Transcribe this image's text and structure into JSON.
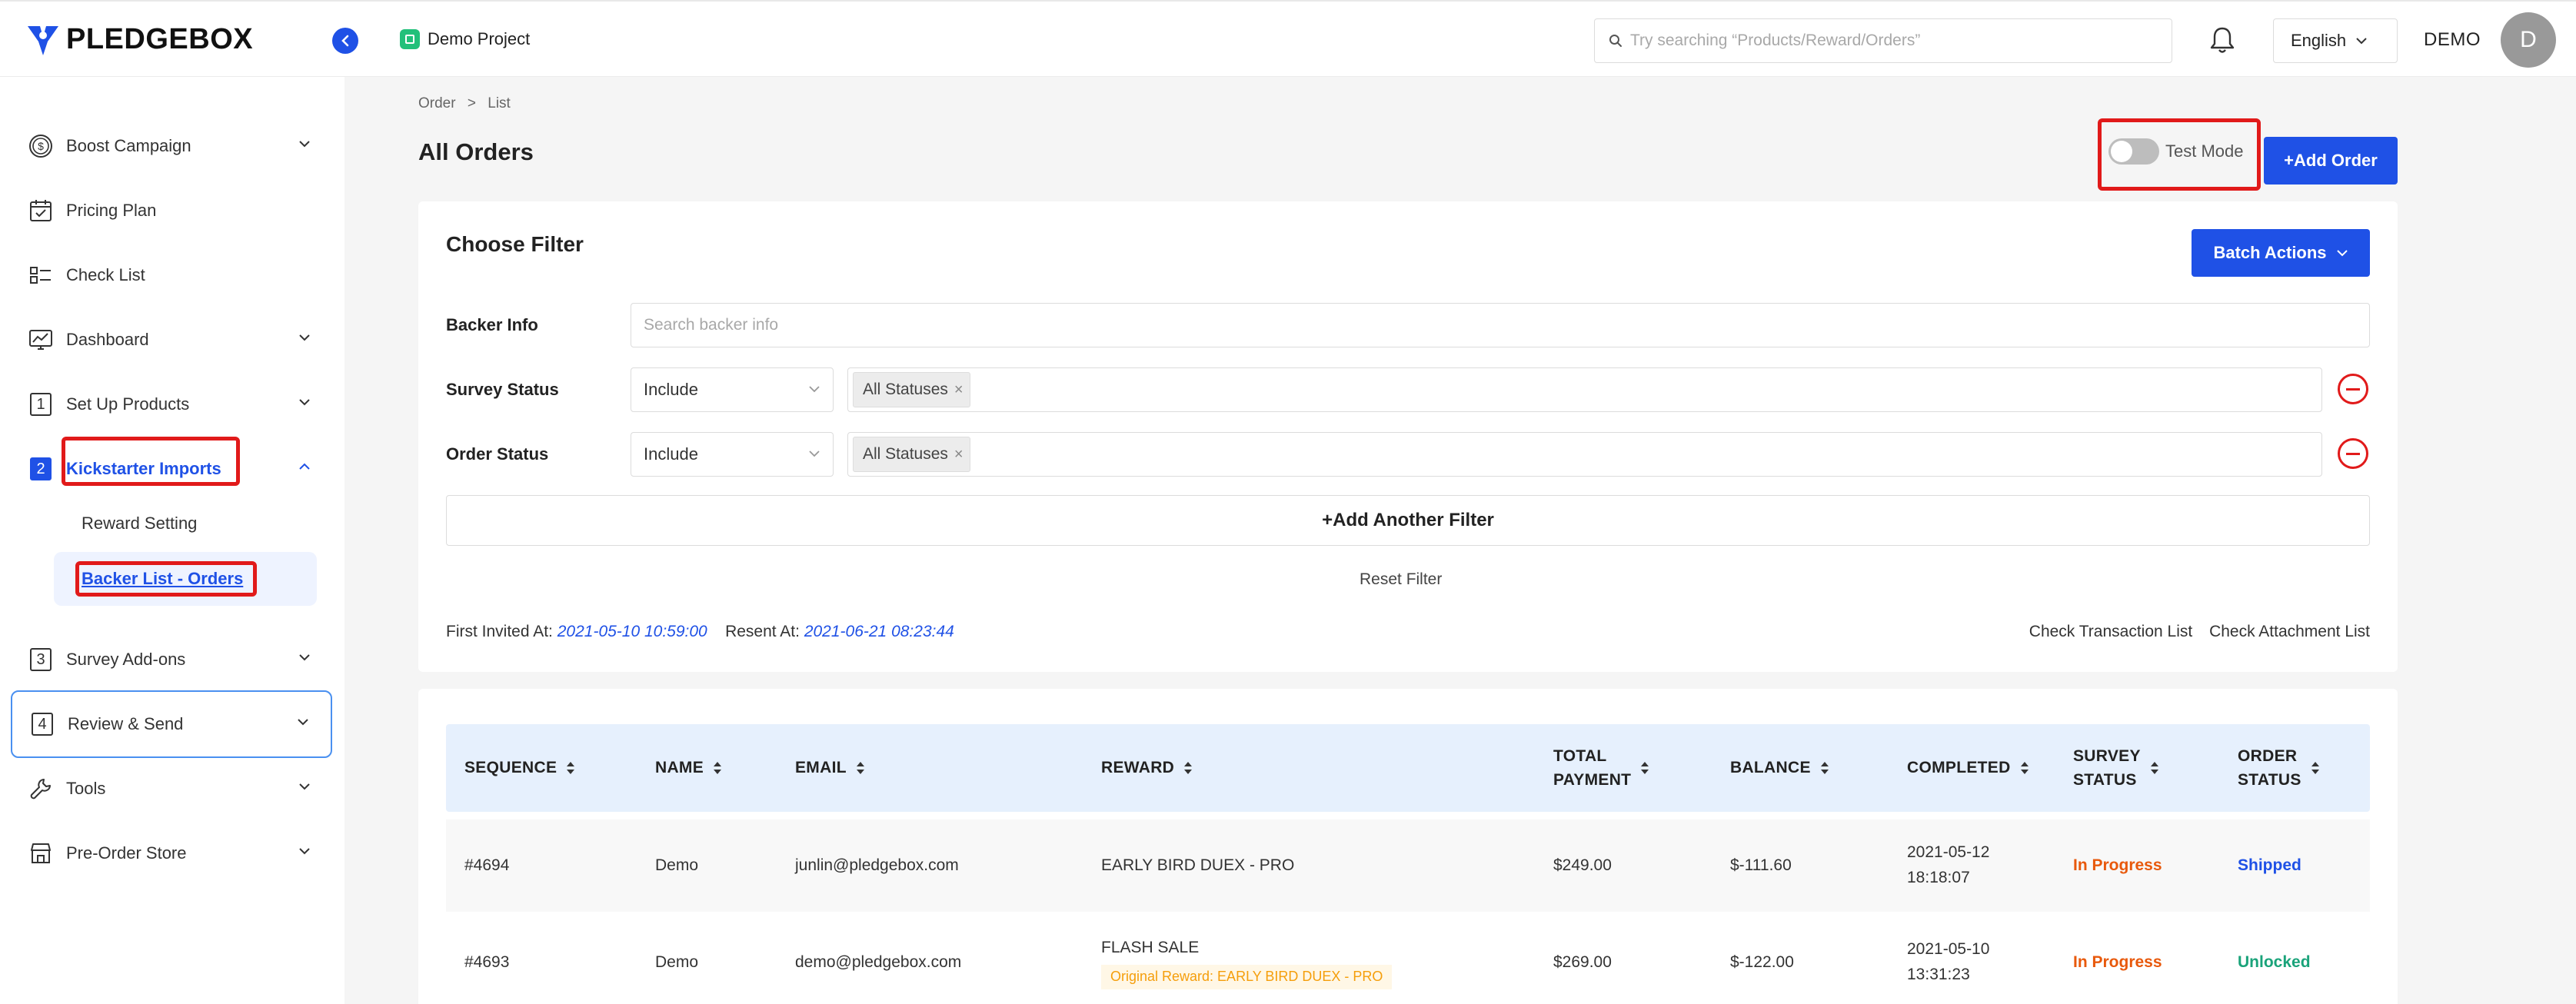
{
  "app": {
    "logo_text": "PLEDGEBOX",
    "project_name": "Demo Project"
  },
  "header": {
    "search_placeholder": "Try searching “Products/Reward/Orders”",
    "language": "English",
    "user_name": "DEMO",
    "avatar_letter": "D"
  },
  "sidebar": {
    "items": [
      {
        "label": "Boost Campaign",
        "icon": "dollar-circle-icon"
      },
      {
        "label": "Pricing Plan",
        "icon": "calendar-check-icon"
      },
      {
        "label": "Check List",
        "icon": "checklist-icon"
      },
      {
        "label": "Dashboard",
        "icon": "dashboard-chart-icon"
      },
      {
        "label": "Set Up Products",
        "icon": "step-1-icon",
        "num": "1"
      },
      {
        "label": "Kickstarter Imports",
        "icon": "step-2-icon",
        "num": "2"
      },
      {
        "label": "Survey Add-ons",
        "icon": "step-3-icon",
        "num": "3"
      },
      {
        "label": "Review & Send",
        "icon": "step-4-icon",
        "num": "4"
      },
      {
        "label": "Tools",
        "icon": "wrench-icon"
      },
      {
        "label": "Pre-Order Store",
        "icon": "store-icon"
      }
    ],
    "sub_items": [
      {
        "label": "Reward Setting"
      },
      {
        "label": "Backer List - Orders"
      }
    ]
  },
  "main": {
    "breadcrumb": [
      "Order",
      ">",
      "List"
    ],
    "title": "All Orders",
    "test_mode_label": "Test Mode",
    "add_order_label": "+Add Order"
  },
  "filter": {
    "title": "Choose Filter",
    "batch_label": "Batch Actions",
    "backer_label": "Backer Info",
    "backer_placeholder": "Search backer info",
    "survey_label": "Survey Status",
    "order_label": "Order Status",
    "include": "Include",
    "tag_all": "All Statuses",
    "tag_x": "×",
    "add_filter": "+Add Another Filter",
    "reset": "Reset Filter",
    "first_invited_label": "First Invited At:",
    "first_invited_date": "2021-05-10 10:59:00",
    "resent_label": "Resent At:",
    "resent_date": "2021-06-21 08:23:44",
    "check_transaction": "Check Transaction List",
    "check_attachment": "Check Attachment List"
  },
  "table": {
    "headers": {
      "sequence": "SEQUENCE",
      "name": "NAME",
      "email": "EMAIL",
      "reward": "REWARD",
      "total_payment_1": "TOTAL",
      "total_payment_2": "PAYMENT",
      "balance": "BALANCE",
      "completed": "COMPLETED",
      "survey_1": "SURVEY",
      "survey_2": "STATUS",
      "order_1": "ORDER",
      "order_2": "STATUS"
    },
    "rows": [
      {
        "sequence": "#4694",
        "name": "Demo",
        "email": "junlin@pledgebox.com",
        "reward": "EARLY BIRD DUEX - PRO",
        "total": "$249.00",
        "balance": "$-111.60",
        "completed_date": "2021-05-12",
        "completed_time": "18:18:07",
        "survey_status": "In Progress",
        "order_status": "Shipped"
      },
      {
        "sequence": "#4693",
        "name": "Demo",
        "email": "demo@pledgebox.com",
        "reward": "FLASH SALE",
        "original_reward": "Original Reward: EARLY BIRD DUEX - PRO",
        "total": "$269.00",
        "balance": "$-122.00",
        "completed_date": "2021-05-10",
        "completed_time": "13:31:23",
        "survey_status": "In Progress",
        "order_status": "Unlocked"
      }
    ]
  },
  "colors": {
    "primary": "#1f51e6",
    "danger": "#e11a1a",
    "in_progress": "#e8590c",
    "unlocked": "#1aa37a",
    "table_header": "#e6f0fd"
  }
}
